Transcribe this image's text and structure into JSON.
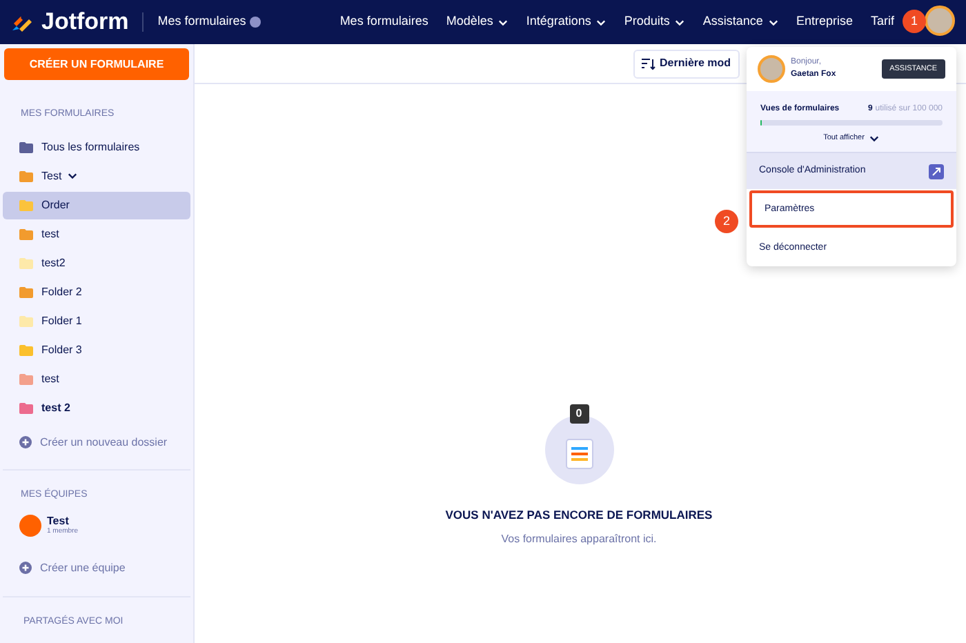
{
  "header": {
    "logo": "Jotform",
    "breadcrumb": "Mes formulaires",
    "nav": [
      {
        "label": "Mes formulaires",
        "dropdown": false
      },
      {
        "label": "Modèles",
        "dropdown": true
      },
      {
        "label": "Intégrations",
        "dropdown": true
      },
      {
        "label": "Produits",
        "dropdown": true
      },
      {
        "label": "Assistance",
        "dropdown": true
      },
      {
        "label": "Entreprise",
        "dropdown": false
      },
      {
        "label": "Tarif",
        "dropdown": false
      }
    ]
  },
  "steps": [
    "1",
    "2"
  ],
  "sidebar": {
    "create_button": "CRÉER UN FORMULAIRE",
    "section_title": "MES FORMULAIRES",
    "folders": [
      {
        "label": "Tous les formulaires",
        "color": "#5b5f97",
        "selected": false,
        "dropdown": false,
        "bold": false
      },
      {
        "label": "Test",
        "color": "#f29b2e",
        "selected": false,
        "dropdown": true,
        "bold": false
      },
      {
        "label": "Order",
        "color": "#fbc33c",
        "selected": true,
        "dropdown": false,
        "bold": false
      },
      {
        "label": "test",
        "color": "#f29b2e",
        "selected": false,
        "dropdown": false,
        "bold": false
      },
      {
        "label": "test2",
        "color": "#fde9a9",
        "selected": false,
        "dropdown": false,
        "bold": false
      },
      {
        "label": "Folder 2",
        "color": "#f29b2e",
        "selected": false,
        "dropdown": false,
        "bold": false
      },
      {
        "label": "Folder 1",
        "color": "#fde9a9",
        "selected": false,
        "dropdown": false,
        "bold": false
      },
      {
        "label": "Folder 3",
        "color": "#fbc02d",
        "selected": false,
        "dropdown": false,
        "bold": false
      },
      {
        "label": "test",
        "color": "#f3a08c",
        "selected": false,
        "dropdown": false,
        "bold": false
      },
      {
        "label": "test 2",
        "color": "#ec6b8e",
        "selected": false,
        "dropdown": false,
        "bold": true
      }
    ],
    "new_folder": "Créer un nouveau dossier",
    "teams_title": "MES ÉQUIPES",
    "team": {
      "name": "Test",
      "members": "1 membre"
    },
    "new_team": "Créer une équipe",
    "shared_title": "PARTAGÉS AVEC MOI"
  },
  "sort_button": "Dernière mod",
  "user_menu": {
    "greeting": "Bonjour,",
    "name": "Gaetan Fox",
    "assistance_button": "ASSISTANCE",
    "views_label": "Vues de formulaires",
    "views_count": "9",
    "views_total": "utilisé sur 100 000",
    "level": 0.01,
    "show_all": "Tout afficher",
    "items": [
      {
        "label": "Console d'Administration",
        "kind": "admin",
        "highlighted": false
      },
      {
        "label": "Paramètres",
        "kind": "plain",
        "highlighted": true
      },
      {
        "label": "Se déconnecter",
        "kind": "plain",
        "highlighted": false
      }
    ]
  },
  "empty_state": {
    "count": "0",
    "title": "VOUS N'AVEZ PAS ENCORE DE FORMULAIRES",
    "subtitle": "Vos formulaires apparaîtront ici."
  }
}
